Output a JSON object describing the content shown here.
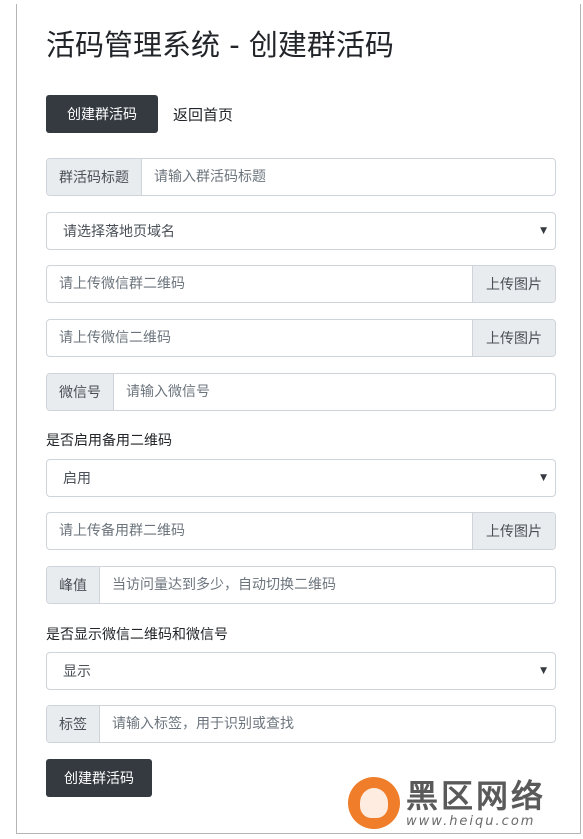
{
  "page": {
    "title": "活码管理系统 - 创建群活码"
  },
  "nav": {
    "create_label": "创建群活码",
    "home_label": "返回首页"
  },
  "form": {
    "group_title": {
      "addon": "群活码标题",
      "placeholder": "请输入群活码标题"
    },
    "domain_select": {
      "selected": "请选择落地页域名"
    },
    "wechat_group_qr": {
      "placeholder": "请上传微信群二维码",
      "button": "上传图片"
    },
    "wechat_qr": {
      "placeholder": "请上传微信二维码",
      "button": "上传图片"
    },
    "wechat_id": {
      "addon": "微信号",
      "placeholder": "请输入微信号"
    },
    "backup_toggle": {
      "label": "是否启用备用二维码",
      "selected": "启用"
    },
    "backup_group_qr": {
      "placeholder": "请上传备用群二维码",
      "button": "上传图片"
    },
    "peak": {
      "addon": "峰值",
      "placeholder": "当访问量达到多少，自动切换二维码"
    },
    "show_wechat": {
      "label": "是否显示微信二维码和微信号",
      "selected": "显示"
    },
    "tag": {
      "addon": "标签",
      "placeholder": "请输入标签，用于识别或查找"
    },
    "submit_label": "创建群活码"
  },
  "watermark": {
    "main": "黑区网络",
    "sub": "www.heiqu.com"
  },
  "icons": {
    "select_caret": "▼"
  },
  "colors": {
    "dark_button": "#343a40",
    "addon_bg": "#e9ecef",
    "border": "#ced4da",
    "watermark_orange": "#ef7d2a"
  }
}
